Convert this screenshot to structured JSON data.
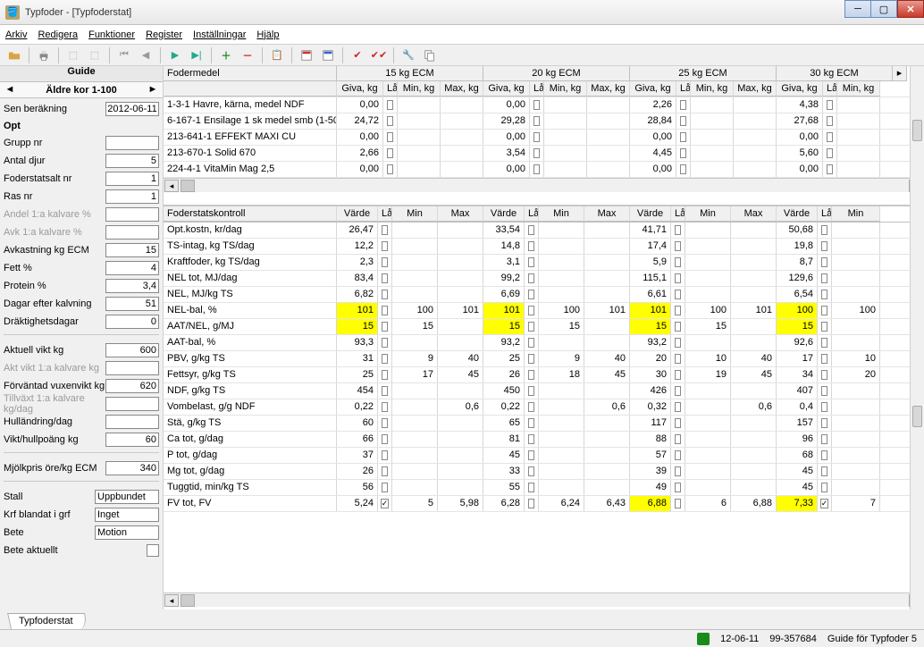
{
  "window": {
    "title": "Typfoder - [Typfoderstat]"
  },
  "menu": [
    "Arkiv",
    "Redigera",
    "Funktioner",
    "Register",
    "Inställningar",
    "Hjälp"
  ],
  "toolbar_icons": [
    "open",
    "print",
    "imp1",
    "imp2",
    "nav-first",
    "nav-prev",
    "play",
    "play-end",
    "add",
    "remove",
    "paste",
    "calc-red",
    "calc-blue",
    "check",
    "double-check",
    "tool",
    "copy"
  ],
  "guide": {
    "title": "Guide",
    "nav_label": "Äldre kor 1-100",
    "calc_label": "Sen beräkning",
    "calc_date": "2012-06-11",
    "opt": "Opt",
    "rows": [
      {
        "label": "Grupp nr",
        "value": "",
        "dim": false
      },
      {
        "label": "Antal djur",
        "value": "5",
        "dim": false
      },
      {
        "label": "Foderstatsalt nr",
        "value": "1",
        "dim": false
      },
      {
        "label": "Ras nr",
        "value": "1",
        "dim": false
      }
    ],
    "rows_dim": [
      {
        "label": "Andel 1:a kalvare %",
        "value": ""
      },
      {
        "label": "Avk 1:a kalvare %",
        "value": ""
      }
    ],
    "rows2": [
      {
        "label": "Avkastning kg ECM",
        "value": "15"
      },
      {
        "label": "Fett %",
        "value": "4"
      },
      {
        "label": "Protein %",
        "value": "3,4"
      },
      {
        "label": "Dagar efter kalvning",
        "value": "51"
      },
      {
        "label": "Dräktighetsdagar",
        "value": "0"
      }
    ],
    "rows3": [
      {
        "label": "Aktuell vikt kg",
        "value": "600",
        "dim": false
      },
      {
        "label": "Akt vikt 1:a kalvare kg",
        "value": "",
        "dim": true
      },
      {
        "label": "Förväntad vuxenvikt kg",
        "value": "620",
        "dim": false
      },
      {
        "label": "Tillväxt 1:a kalvare kg/dag",
        "value": "",
        "dim": true
      },
      {
        "label": "Hulländring/dag",
        "value": "",
        "dim": false
      },
      {
        "label": "Vikt/hullpoäng kg",
        "value": "60",
        "dim": false
      }
    ],
    "rows4": [
      {
        "label": "Mjölkpris öre/kg ECM",
        "value": "340"
      }
    ],
    "rows5": [
      {
        "label": "Stall",
        "value": "Uppbundet",
        "wide": true
      },
      {
        "label": "Krf blandat i grf",
        "value": "Inget",
        "wide": true
      },
      {
        "label": "Bete",
        "value": "Motion",
        "wide": true
      }
    ],
    "bete_aktuellt": "Bete aktuellt"
  },
  "feed": {
    "fodermedel_label": "Fodermedel",
    "groups": [
      "15 kg ECM",
      "20 kg ECM",
      "25 kg ECM",
      "30 kg ECM"
    ],
    "cols": [
      "Giva, kg",
      "Lås",
      "Min, kg",
      "Max, kg"
    ],
    "min_cols_short": [
      "Giva, kg",
      "Lås",
      "Min, kg"
    ],
    "items": [
      {
        "name": "1-3-1 Havre, kärna, medel NDF",
        "v": [
          "0,00",
          "0,00",
          "2,26",
          "4,38"
        ]
      },
      {
        "name": "6-167-1 Ensilage 1 sk medel smb (1-50",
        "v": [
          "24,72",
          "29,28",
          "28,84",
          "27,68"
        ]
      },
      {
        "name": "213-641-1 EFFEKT MAXI CU",
        "v": [
          "0,00",
          "0,00",
          "0,00",
          "0,00"
        ]
      },
      {
        "name": "213-670-1 Solid 670",
        "v": [
          "2,66",
          "3,54",
          "4,45",
          "5,60"
        ]
      },
      {
        "name": "224-4-1 VitaMin Mag 2,5",
        "v": [
          "0,00",
          "0,00",
          "0,00",
          "0,00"
        ]
      }
    ]
  },
  "ctrl": {
    "header_label": "Foderstatskontroll",
    "cols": [
      "Värde",
      "Lås",
      "Min",
      "Max"
    ],
    "cols_last": [
      "Värde",
      "Lås",
      "Min"
    ],
    "rows": [
      {
        "n": "Opt.kostn, kr/dag",
        "v": [
          "26,47",
          "",
          "",
          "",
          "33,54",
          "",
          "",
          "",
          "41,71",
          "",
          "",
          "",
          "50,68",
          "",
          ""
        ]
      },
      {
        "n": "TS-intag, kg TS/dag",
        "v": [
          "12,2",
          "",
          "",
          "",
          "14,8",
          "",
          "",
          "",
          "17,4",
          "",
          "",
          "",
          "19,8",
          "",
          ""
        ]
      },
      {
        "n": "Kraftfoder, kg TS/dag",
        "v": [
          "2,3",
          "",
          "",
          "",
          "3,1",
          "",
          "",
          "",
          "5,9",
          "",
          "",
          "",
          "8,7",
          "",
          ""
        ]
      },
      {
        "n": "NEL tot, MJ/dag",
        "v": [
          "83,4",
          "",
          "",
          "",
          "99,2",
          "",
          "",
          "",
          "115,1",
          "",
          "",
          "",
          "129,6",
          "",
          ""
        ]
      },
      {
        "n": "NEL, MJ/kg TS",
        "v": [
          "6,82",
          "",
          "",
          "",
          "6,69",
          "",
          "",
          "",
          "6,61",
          "",
          "",
          "",
          "6,54",
          "",
          ""
        ]
      },
      {
        "n": "NEL-bal, %",
        "v": [
          "101",
          "",
          "100",
          "101",
          "101",
          "",
          "100",
          "101",
          "101",
          "",
          "100",
          "101",
          "100",
          "",
          "100"
        ],
        "hl": [
          0,
          4,
          8,
          12
        ]
      },
      {
        "n": "AAT/NEL, g/MJ",
        "v": [
          "15",
          "",
          "15",
          "",
          "15",
          "",
          "15",
          "",
          "15",
          "",
          "15",
          "",
          "15",
          "",
          ""
        ],
        "hl": [
          0,
          4,
          8,
          12
        ]
      },
      {
        "n": "AAT-bal, %",
        "v": [
          "93,3",
          "",
          "",
          "",
          "93,2",
          "",
          "",
          "",
          "93,2",
          "",
          "",
          "",
          "92,6",
          "",
          ""
        ]
      },
      {
        "n": "PBV, g/kg TS",
        "v": [
          "31",
          "",
          "9",
          "40",
          "25",
          "",
          "9",
          "40",
          "20",
          "",
          "10",
          "40",
          "17",
          "",
          "10"
        ]
      },
      {
        "n": "Fettsyr, g/kg TS",
        "v": [
          "25",
          "",
          "17",
          "45",
          "26",
          "",
          "18",
          "45",
          "30",
          "",
          "19",
          "45",
          "34",
          "",
          "20"
        ]
      },
      {
        "n": "NDF, g/kg TS",
        "v": [
          "454",
          "",
          "",
          "",
          "450",
          "",
          "",
          "",
          "426",
          "",
          "",
          "",
          "407",
          "",
          ""
        ]
      },
      {
        "n": "Vombelast, g/g NDF",
        "v": [
          "0,22",
          "",
          "",
          "0,6",
          "0,22",
          "",
          "",
          "0,6",
          "0,32",
          "",
          "",
          "0,6",
          "0,4",
          "",
          ""
        ]
      },
      {
        "n": "Stä, g/kg TS",
        "v": [
          "60",
          "",
          "",
          "",
          "65",
          "",
          "",
          "",
          "117",
          "",
          "",
          "",
          "157",
          "",
          ""
        ]
      },
      {
        "n": "Ca tot, g/dag",
        "v": [
          "66",
          "",
          "",
          "",
          "81",
          "",
          "",
          "",
          "88",
          "",
          "",
          "",
          "96",
          "",
          ""
        ]
      },
      {
        "n": "P tot, g/dag",
        "v": [
          "37",
          "",
          "",
          "",
          "45",
          "",
          "",
          "",
          "57",
          "",
          "",
          "",
          "68",
          "",
          ""
        ]
      },
      {
        "n": "Mg tot, g/dag",
        "v": [
          "26",
          "",
          "",
          "",
          "33",
          "",
          "",
          "",
          "39",
          "",
          "",
          "",
          "45",
          "",
          ""
        ]
      },
      {
        "n": "Tuggtid, min/kg TS",
        "v": [
          "56",
          "",
          "",
          "",
          "55",
          "",
          "",
          "",
          "49",
          "",
          "",
          "",
          "45",
          "",
          ""
        ]
      },
      {
        "n": "FV tot, FV",
        "v": [
          "5,24",
          "✓",
          "5",
          "5,98",
          "6,28",
          "",
          "6,24",
          "6,43",
          "6,88",
          "",
          "6",
          "6,88",
          "7,33",
          "✓",
          "7"
        ],
        "hl": [
          8,
          12
        ]
      }
    ]
  },
  "tab": "Typfoderstat",
  "status": {
    "date": "12-06-11",
    "code": "99-357684",
    "text": "Guide för Typfoder 5"
  }
}
